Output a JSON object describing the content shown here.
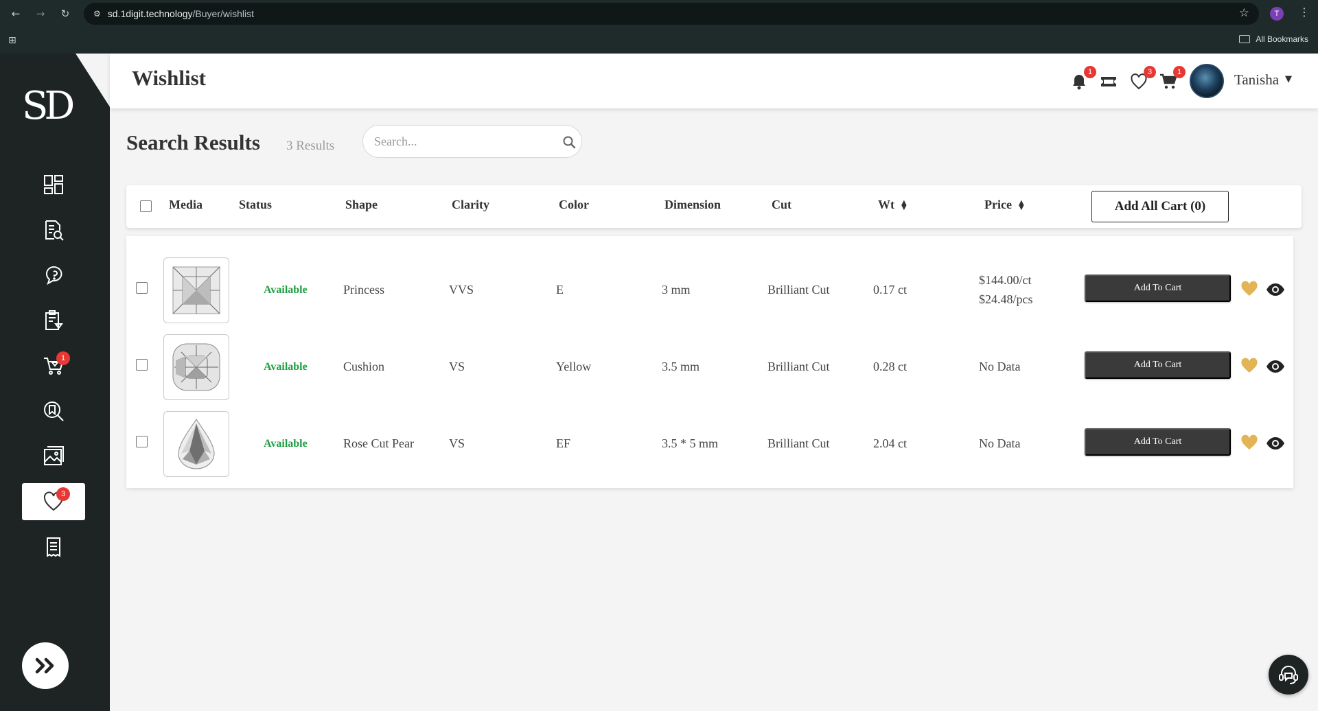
{
  "browser": {
    "url_host": "sd.1digit.technology",
    "url_path": "/Buyer/wishlist",
    "profile_initial": "T",
    "bookmarks_label": "All Bookmarks"
  },
  "sidebar": {
    "logo": "SD",
    "items": [
      {
        "name": "dashboard",
        "icon": "dashboard-grid-icon"
      },
      {
        "name": "search-document",
        "icon": "document-search-icon"
      },
      {
        "name": "inquiries",
        "icon": "chat-question-icon"
      },
      {
        "name": "orders",
        "icon": "clipboard-gem-icon"
      },
      {
        "name": "cart",
        "icon": "cart-gem-icon",
        "badge": "1"
      },
      {
        "name": "saved-search",
        "icon": "search-bookmark-icon"
      },
      {
        "name": "gallery",
        "icon": "image-gallery-icon"
      },
      {
        "name": "wishlist",
        "icon": "heart-icon",
        "badge": "3",
        "active": true
      },
      {
        "name": "invoices",
        "icon": "receipt-icon"
      }
    ]
  },
  "header": {
    "title": "Wishlist",
    "notifications_badge": "1",
    "wishlist_badge": "3",
    "cart_badge": "1",
    "username": "Tanisha"
  },
  "search": {
    "title": "Search Results",
    "count": "3 Results",
    "placeholder": "Search..."
  },
  "table": {
    "columns": {
      "media": "Media",
      "status": "Status",
      "shape": "Shape",
      "clarity": "Clarity",
      "color": "Color",
      "dimension": "Dimension",
      "cut": "Cut",
      "wt": "Wt",
      "price": "Price"
    },
    "add_all_label": "Add All Cart (0)",
    "add_to_cart_label": "Add To Cart",
    "rows": [
      {
        "status": "Available",
        "shape": "Princess",
        "clarity": "VVS",
        "color": "E",
        "dimension": "3 mm",
        "cut": "Brilliant Cut",
        "wt": "0.17 ct",
        "price_ct": "$144.00/ct",
        "price_pcs": "$24.48/pcs",
        "image": "princess-diamond"
      },
      {
        "status": "Available",
        "shape": "Cushion",
        "clarity": "VS",
        "color": "Yellow",
        "dimension": "3.5 mm",
        "cut": "Brilliant Cut",
        "wt": "0.28 ct",
        "price_ct": "No Data",
        "price_pcs": "",
        "image": "cushion-diamond"
      },
      {
        "status": "Available",
        "shape": "Rose Cut Pear",
        "clarity": "VS",
        "color": "EF",
        "dimension": "3.5 * 5 mm",
        "cut": "Brilliant Cut",
        "wt": "2.04 ct",
        "price_ct": "No Data",
        "price_pcs": "",
        "image": "pear-diamond"
      }
    ]
  },
  "colors": {
    "sidebar_bg": "#1e2424",
    "status_available": "#1e9e3f",
    "badge": "#e53935",
    "heart_gold": "#e2b455",
    "button_dark": "#3a3a3a"
  }
}
